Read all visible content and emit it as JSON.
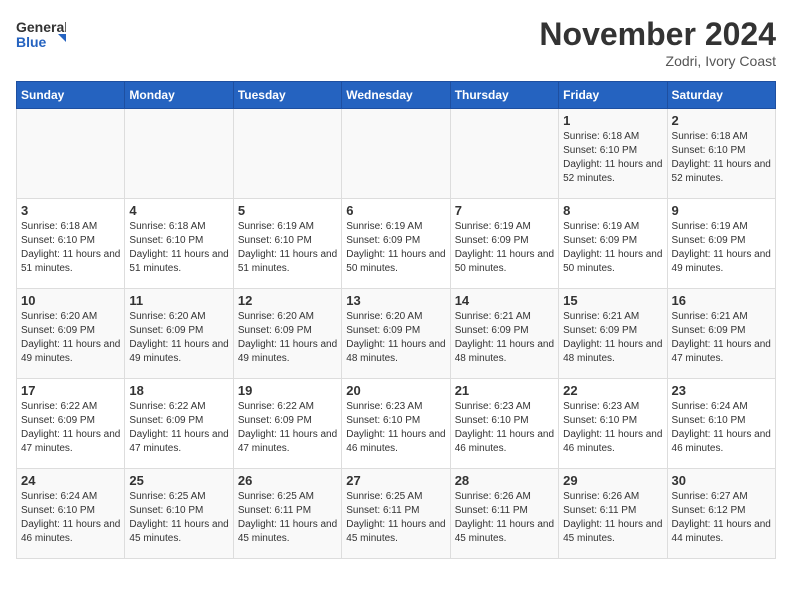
{
  "header": {
    "logo_line1": "General",
    "logo_line2": "Blue",
    "month_title": "November 2024",
    "location": "Zodri, Ivory Coast"
  },
  "weekdays": [
    "Sunday",
    "Monday",
    "Tuesday",
    "Wednesday",
    "Thursday",
    "Friday",
    "Saturday"
  ],
  "weeks": [
    [
      {
        "day": "",
        "info": ""
      },
      {
        "day": "",
        "info": ""
      },
      {
        "day": "",
        "info": ""
      },
      {
        "day": "",
        "info": ""
      },
      {
        "day": "",
        "info": ""
      },
      {
        "day": "1",
        "info": "Sunrise: 6:18 AM\nSunset: 6:10 PM\nDaylight: 11 hours and 52 minutes."
      },
      {
        "day": "2",
        "info": "Sunrise: 6:18 AM\nSunset: 6:10 PM\nDaylight: 11 hours and 52 minutes."
      }
    ],
    [
      {
        "day": "3",
        "info": "Sunrise: 6:18 AM\nSunset: 6:10 PM\nDaylight: 11 hours and 51 minutes."
      },
      {
        "day": "4",
        "info": "Sunrise: 6:18 AM\nSunset: 6:10 PM\nDaylight: 11 hours and 51 minutes."
      },
      {
        "day": "5",
        "info": "Sunrise: 6:19 AM\nSunset: 6:10 PM\nDaylight: 11 hours and 51 minutes."
      },
      {
        "day": "6",
        "info": "Sunrise: 6:19 AM\nSunset: 6:09 PM\nDaylight: 11 hours and 50 minutes."
      },
      {
        "day": "7",
        "info": "Sunrise: 6:19 AM\nSunset: 6:09 PM\nDaylight: 11 hours and 50 minutes."
      },
      {
        "day": "8",
        "info": "Sunrise: 6:19 AM\nSunset: 6:09 PM\nDaylight: 11 hours and 50 minutes."
      },
      {
        "day": "9",
        "info": "Sunrise: 6:19 AM\nSunset: 6:09 PM\nDaylight: 11 hours and 49 minutes."
      }
    ],
    [
      {
        "day": "10",
        "info": "Sunrise: 6:20 AM\nSunset: 6:09 PM\nDaylight: 11 hours and 49 minutes."
      },
      {
        "day": "11",
        "info": "Sunrise: 6:20 AM\nSunset: 6:09 PM\nDaylight: 11 hours and 49 minutes."
      },
      {
        "day": "12",
        "info": "Sunrise: 6:20 AM\nSunset: 6:09 PM\nDaylight: 11 hours and 49 minutes."
      },
      {
        "day": "13",
        "info": "Sunrise: 6:20 AM\nSunset: 6:09 PM\nDaylight: 11 hours and 48 minutes."
      },
      {
        "day": "14",
        "info": "Sunrise: 6:21 AM\nSunset: 6:09 PM\nDaylight: 11 hours and 48 minutes."
      },
      {
        "day": "15",
        "info": "Sunrise: 6:21 AM\nSunset: 6:09 PM\nDaylight: 11 hours and 48 minutes."
      },
      {
        "day": "16",
        "info": "Sunrise: 6:21 AM\nSunset: 6:09 PM\nDaylight: 11 hours and 47 minutes."
      }
    ],
    [
      {
        "day": "17",
        "info": "Sunrise: 6:22 AM\nSunset: 6:09 PM\nDaylight: 11 hours and 47 minutes."
      },
      {
        "day": "18",
        "info": "Sunrise: 6:22 AM\nSunset: 6:09 PM\nDaylight: 11 hours and 47 minutes."
      },
      {
        "day": "19",
        "info": "Sunrise: 6:22 AM\nSunset: 6:09 PM\nDaylight: 11 hours and 47 minutes."
      },
      {
        "day": "20",
        "info": "Sunrise: 6:23 AM\nSunset: 6:10 PM\nDaylight: 11 hours and 46 minutes."
      },
      {
        "day": "21",
        "info": "Sunrise: 6:23 AM\nSunset: 6:10 PM\nDaylight: 11 hours and 46 minutes."
      },
      {
        "day": "22",
        "info": "Sunrise: 6:23 AM\nSunset: 6:10 PM\nDaylight: 11 hours and 46 minutes."
      },
      {
        "day": "23",
        "info": "Sunrise: 6:24 AM\nSunset: 6:10 PM\nDaylight: 11 hours and 46 minutes."
      }
    ],
    [
      {
        "day": "24",
        "info": "Sunrise: 6:24 AM\nSunset: 6:10 PM\nDaylight: 11 hours and 46 minutes."
      },
      {
        "day": "25",
        "info": "Sunrise: 6:25 AM\nSunset: 6:10 PM\nDaylight: 11 hours and 45 minutes."
      },
      {
        "day": "26",
        "info": "Sunrise: 6:25 AM\nSunset: 6:11 PM\nDaylight: 11 hours and 45 minutes."
      },
      {
        "day": "27",
        "info": "Sunrise: 6:25 AM\nSunset: 6:11 PM\nDaylight: 11 hours and 45 minutes."
      },
      {
        "day": "28",
        "info": "Sunrise: 6:26 AM\nSunset: 6:11 PM\nDaylight: 11 hours and 45 minutes."
      },
      {
        "day": "29",
        "info": "Sunrise: 6:26 AM\nSunset: 6:11 PM\nDaylight: 11 hours and 45 minutes."
      },
      {
        "day": "30",
        "info": "Sunrise: 6:27 AM\nSunset: 6:12 PM\nDaylight: 11 hours and 44 minutes."
      }
    ]
  ]
}
